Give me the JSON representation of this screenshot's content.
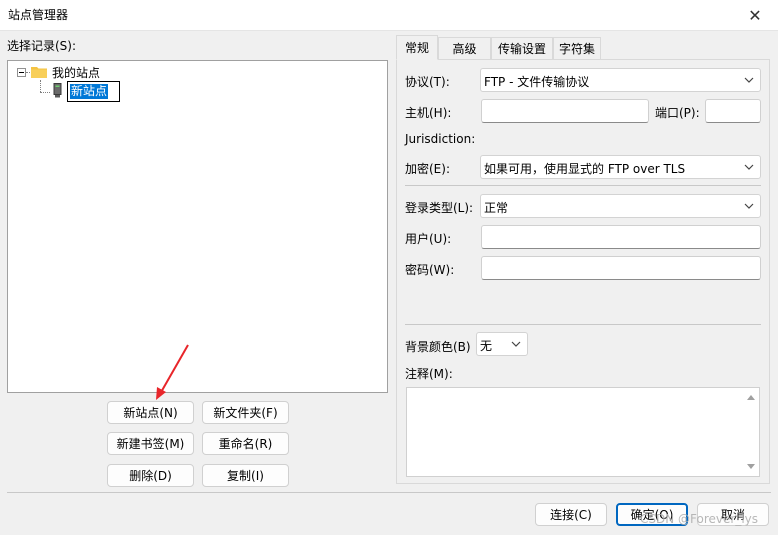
{
  "window": {
    "title": "站点管理器"
  },
  "left": {
    "select_label": "选择记录(S):",
    "tree": {
      "root": "我的站点",
      "child_editing": "新站点"
    },
    "buttons": {
      "new_site": "新站点(N)",
      "new_folder": "新文件夹(F)",
      "new_bookmark": "新建书签(M)",
      "rename": "重命名(R)",
      "delete": "删除(D)",
      "copy": "复制(I)"
    }
  },
  "tabs": [
    {
      "label": "常规",
      "active": true
    },
    {
      "label": "高级",
      "active": false
    },
    {
      "label": "传输设置",
      "active": false
    },
    {
      "label": "字符集",
      "active": false
    }
  ],
  "general": {
    "protocol_label": "协议(T):",
    "protocol_value": "FTP - 文件传输协议",
    "host_label": "主机(H):",
    "host_value": "",
    "port_label": "端口(P):",
    "port_value": "",
    "jurisdiction_label": "Jurisdiction:",
    "encryption_label": "加密(E):",
    "encryption_value": "如果可用，使用显式的 FTP over TLS",
    "logon_type_label": "登录类型(L):",
    "logon_type_value": "正常",
    "user_label": "用户(U):",
    "user_value": "",
    "password_label": "密码(W):",
    "password_value": "",
    "bgcolor_label": "背景颜色(B)",
    "bgcolor_value": "无",
    "comments_label": "注释(M):",
    "comments_value": ""
  },
  "footer": {
    "connect": "连接(C)",
    "ok": "确定(O)",
    "cancel": "取消"
  },
  "watermark": "CSDN @Forever_lys",
  "colors": {
    "selection": "#0078d7",
    "annotation_arrow": "#e8252a",
    "folder": "#f5c342"
  }
}
